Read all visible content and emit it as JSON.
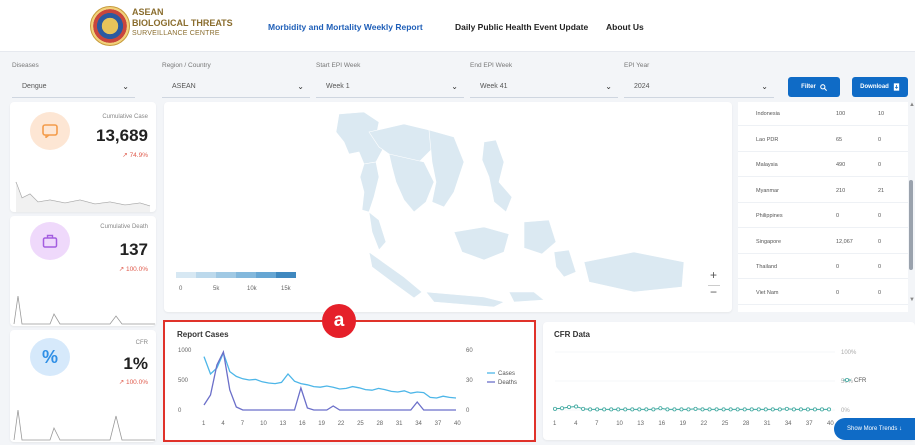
{
  "header": {
    "logo_line1": "ASEAN",
    "logo_line2": "BIOLOGICAL THREATS",
    "logo_line3": "SURVEILLANCE CENTRE",
    "nav": [
      "Morbidity and Mortality Weekly Report",
      "Daily Public Health Event Update",
      "About Us"
    ]
  },
  "filters": {
    "diseases_label": "Diseases",
    "diseases_value": "Dengue",
    "region_label": "Region / Country",
    "region_value": "ASEAN",
    "start_label": "Start EPI Week",
    "start_value": "Week 1",
    "end_label": "End EPI Week",
    "end_value": "Week 41",
    "year_label": "EPI Year",
    "year_value": "2024",
    "filter_button": "Filter",
    "download_button": "Download"
  },
  "kpis": [
    {
      "label": "Cumulative Case",
      "value": "13,689",
      "change": "74.9%",
      "icon": "message-icon",
      "color": "#f39c4b"
    },
    {
      "label": "Cumulative Death",
      "value": "137",
      "change": "100.0%",
      "icon": "briefcase-icon",
      "color": "#a45de0"
    },
    {
      "label": "CFR",
      "value": "1%",
      "change": "100.0%",
      "icon": "percent-icon",
      "color": "#2f8fe6"
    }
  ],
  "map": {
    "legend_ticks": [
      "0",
      "5k",
      "10k",
      "15k"
    ],
    "zoom_in": "+",
    "zoom_out": "−"
  },
  "table": {
    "rows": [
      {
        "country": "Indonesia",
        "cases": "100",
        "deaths": "10"
      },
      {
        "country": "Lao PDR",
        "cases": "65",
        "deaths": "0"
      },
      {
        "country": "Malaysia",
        "cases": "490",
        "deaths": "0"
      },
      {
        "country": "Myanmar",
        "cases": "210",
        "deaths": "21"
      },
      {
        "country": "Philippines",
        "cases": "0",
        "deaths": "0"
      },
      {
        "country": "Singapore",
        "cases": "12,067",
        "deaths": "0"
      },
      {
        "country": "Thailand",
        "cases": "0",
        "deaths": "0"
      },
      {
        "country": "Viet Nam",
        "cases": "0",
        "deaths": "0"
      }
    ]
  },
  "report_cases": {
    "title": "Report Cases",
    "badge": "a"
  },
  "cfr_panel": {
    "title": "CFR Data",
    "show_more": "Show More Trends"
  },
  "chart_data": [
    {
      "type": "line",
      "title": "Report Cases",
      "x": [
        1,
        2,
        3,
        4,
        5,
        6,
        7,
        8,
        9,
        10,
        11,
        12,
        13,
        14,
        15,
        16,
        17,
        18,
        19,
        20,
        21,
        22,
        23,
        24,
        25,
        26,
        27,
        28,
        29,
        30,
        31,
        32,
        33,
        34,
        35,
        36,
        37,
        38,
        39,
        40
      ],
      "x_ticks": [
        "1",
        "4",
        "7",
        "10",
        "13",
        "16",
        "19",
        "22",
        "25",
        "28",
        "31",
        "34",
        "37",
        "40"
      ],
      "y_left_ticks": [
        "0",
        "500",
        "1000"
      ],
      "y_right_ticks": [
        "0",
        "30",
        "60"
      ],
      "ylim_left": [
        0,
        1000
      ],
      "ylim_right": [
        0,
        60
      ],
      "series": [
        {
          "name": "Cases",
          "axis": "left",
          "color": "#4db6e8",
          "values": [
            890,
            600,
            700,
            950,
            640,
            560,
            520,
            500,
            510,
            470,
            450,
            440,
            460,
            600,
            480,
            440,
            420,
            390,
            380,
            400,
            380,
            350,
            360,
            390,
            370,
            340,
            330,
            360,
            340,
            310,
            300,
            320,
            280,
            300,
            290,
            210,
            200,
            230,
            210,
            200
          ]
        },
        {
          "name": "Deaths",
          "axis": "right",
          "color": "#6b6fc9",
          "values": [
            5,
            15,
            45,
            58,
            20,
            3,
            0,
            0,
            0,
            0,
            0,
            0,
            0,
            0,
            0,
            22,
            2,
            0,
            0,
            0,
            4,
            0,
            0,
            0,
            0,
            0,
            0,
            0,
            0,
            0,
            0,
            0,
            0,
            8,
            0,
            0,
            0,
            0,
            0,
            0
          ]
        }
      ],
      "legend": "right"
    },
    {
      "type": "line",
      "title": "CFR Data",
      "x": [
        1,
        2,
        3,
        4,
        5,
        6,
        7,
        8,
        9,
        10,
        11,
        12,
        13,
        14,
        15,
        16,
        17,
        18,
        19,
        20,
        21,
        22,
        23,
        24,
        25,
        26,
        27,
        28,
        29,
        30,
        31,
        32,
        33,
        34,
        35,
        36,
        37,
        38,
        39,
        40
      ],
      "x_ticks": [
        "1",
        "4",
        "7",
        "10",
        "13",
        "16",
        "19",
        "22",
        "25",
        "28",
        "31",
        "34",
        "37",
        "40"
      ],
      "y_ticks": [
        "0%",
        "50%",
        "100%"
      ],
      "ylim": [
        0,
        100
      ],
      "series": [
        {
          "name": "CFR",
          "color": "#3fa9a0",
          "values": [
            2,
            3,
            5,
            6,
            2,
            1,
            1,
            1,
            1,
            1,
            1,
            1,
            1,
            1,
            1,
            3,
            1,
            1,
            1,
            1,
            2,
            1,
            1,
            1,
            1,
            1,
            1,
            1,
            1,
            1,
            1,
            1,
            1,
            2,
            1,
            1,
            1,
            1,
            1,
            1
          ]
        }
      ],
      "legend": "right"
    }
  ]
}
